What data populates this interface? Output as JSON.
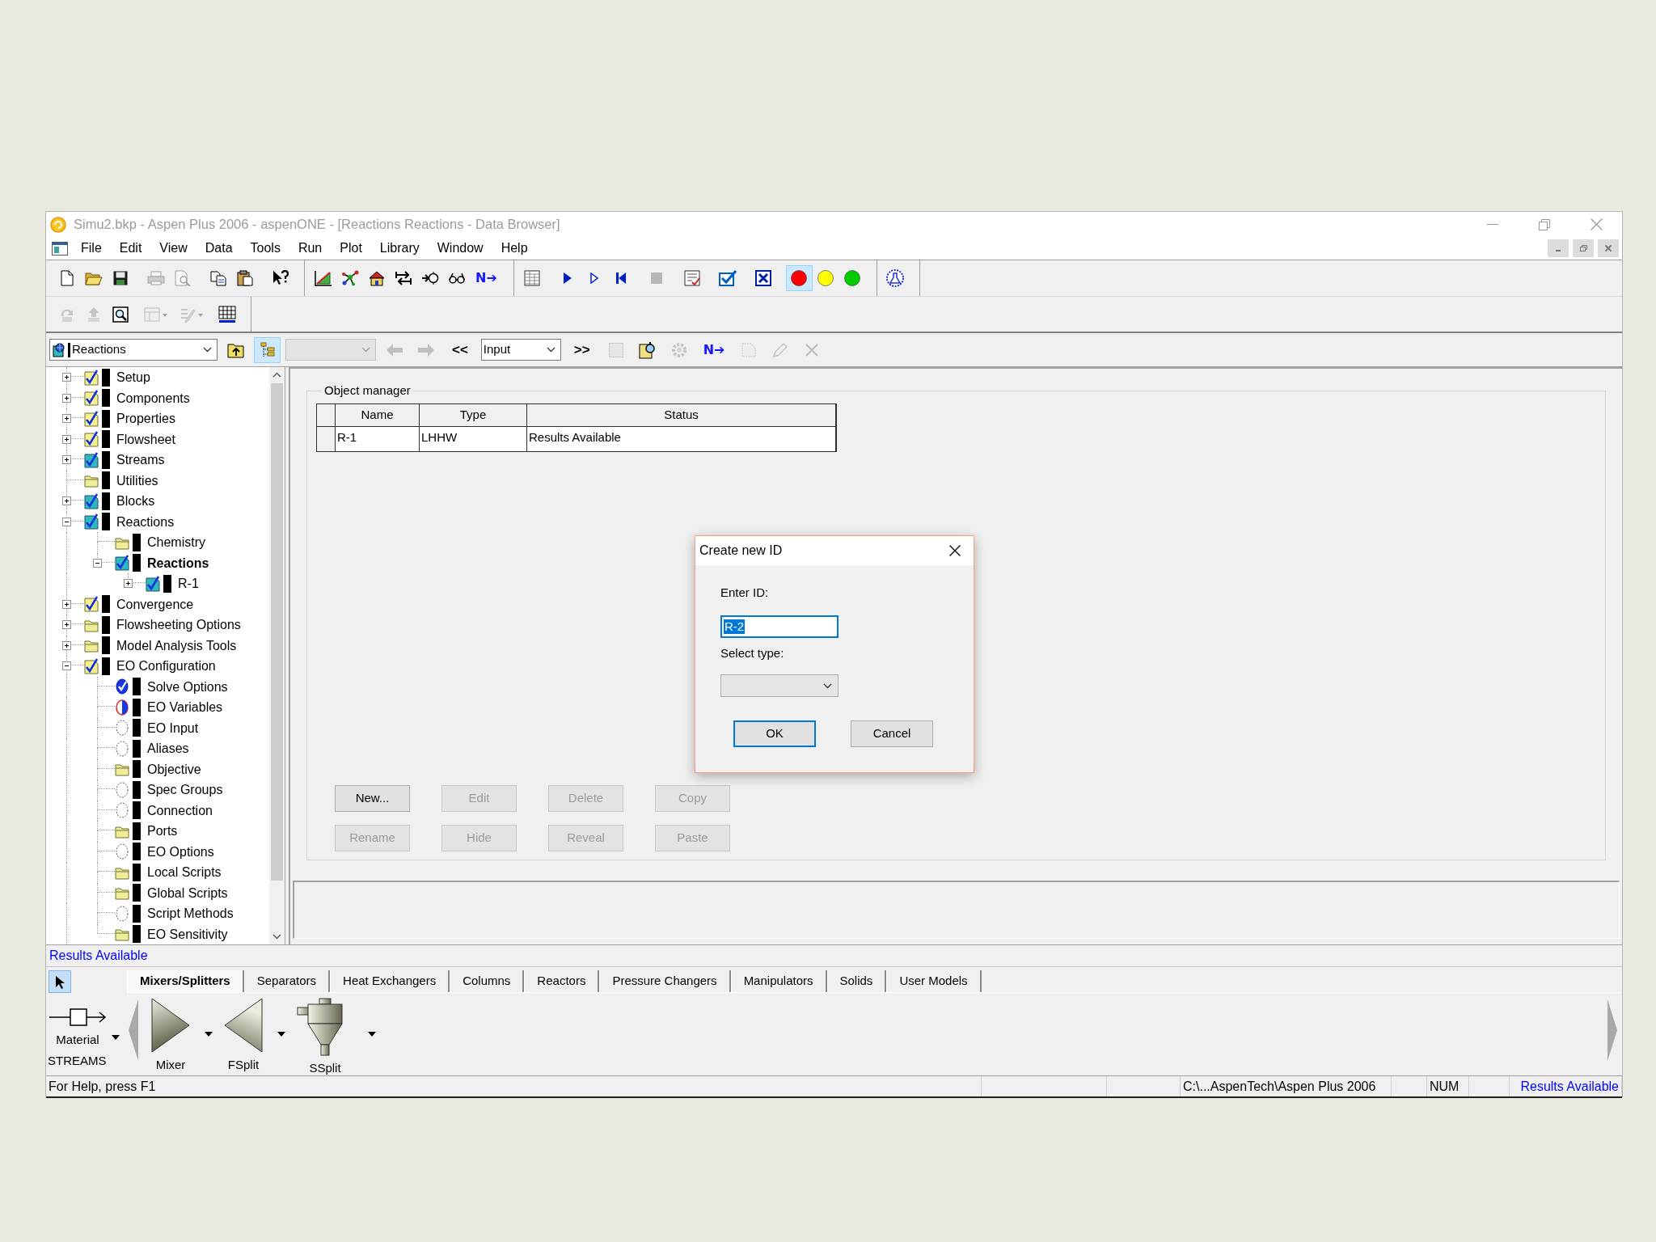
{
  "window": {
    "title": "Simu2.bkp - Aspen Plus 2006 - aspenONE - [Reactions Reactions - Data Browser]"
  },
  "menu": [
    "File",
    "Edit",
    "View",
    "Data",
    "Tools",
    "Run",
    "Plot",
    "Library",
    "Window",
    "Help"
  ],
  "toolbar_1": [
    [
      [
        {
          "kind": "new",
          "disabled": false,
          "pressed": false
        },
        {
          "kind": "open",
          "disabled": false,
          "pressed": false
        },
        {
          "kind": "save",
          "disabled": false,
          "pressed": false
        }
      ],
      [
        {
          "kind": "print",
          "disabled": true,
          "pressed": false
        },
        {
          "kind": "preview",
          "disabled": true,
          "pressed": false
        }
      ],
      [
        {
          "kind": "copy",
          "disabled": false,
          "pressed": false
        },
        {
          "kind": "paste",
          "disabled": false,
          "pressed": false
        }
      ],
      [
        {
          "kind": "help",
          "disabled": false,
          "pressed": false
        }
      ]
    ],
    [
      [
        {
          "kind": "chart",
          "disabled": false,
          "pressed": false
        },
        {
          "kind": "network",
          "disabled": false,
          "pressed": false
        },
        {
          "kind": "house",
          "disabled": false,
          "pressed": false
        },
        {
          "kind": "swap",
          "disabled": false,
          "pressed": false
        },
        {
          "kind": "node",
          "disabled": false,
          "pressed": false
        },
        {
          "kind": "glasses",
          "disabled": false,
          "pressed": false
        },
        {
          "kind": "next",
          "label": "N➔",
          "disabled": false,
          "pressed": false
        }
      ]
    ],
    [
      [
        {
          "kind": "table",
          "disabled": false,
          "pressed": false
        }
      ],
      [
        {
          "kind": "play",
          "disabled": false,
          "pressed": false
        },
        {
          "kind": "step",
          "disabled": false,
          "pressed": false
        },
        {
          "kind": "rewind",
          "disabled": false,
          "pressed": false
        }
      ],
      [
        {
          "kind": "stop",
          "disabled": true,
          "pressed": false
        }
      ],
      [
        {
          "kind": "checklist",
          "disabled": false,
          "pressed": false
        }
      ],
      [
        {
          "kind": "checkbox",
          "disabled": false,
          "pressed": false
        }
      ],
      [
        {
          "kind": "crossbox",
          "disabled": false,
          "pressed": false
        }
      ],
      [
        {
          "kind": "light",
          "color": "#ff0000",
          "disabled": false,
          "pressed": true
        },
        {
          "kind": "light",
          "color": "#ffff00",
          "disabled": false,
          "pressed": false
        },
        {
          "kind": "light",
          "color": "#00cc00",
          "disabled": false,
          "pressed": false
        }
      ]
    ],
    [
      [
        {
          "kind": "flask",
          "disabled": false,
          "pressed": false
        }
      ]
    ]
  ],
  "toolbar_2": [
    [
      [
        {
          "kind": "curve-left",
          "disabled": true,
          "pressed": false
        },
        {
          "kind": "curve-up",
          "disabled": true,
          "pressed": false
        },
        {
          "kind": "zoom-frame",
          "disabled": false,
          "pressed": false
        }
      ],
      [
        {
          "kind": "layout",
          "disabled": true,
          "pressed": false
        }
      ],
      [
        {
          "kind": "pencil-list",
          "disabled": true,
          "pressed": false
        }
      ],
      [
        {
          "kind": "grid-line",
          "disabled": false,
          "pressed": false
        }
      ]
    ]
  ],
  "browser_bar": [
    {
      "kind": "object-combo",
      "value": "Reactions",
      "disabled": false,
      "pressed": false
    },
    {
      "kind": "folder-up",
      "disabled": false,
      "pressed": false
    },
    {
      "kind": "tree-view",
      "disabled": false,
      "pressed": true
    },
    {
      "kind": "view-combo",
      "disabled": true,
      "pressed": false
    },
    {
      "kind": "back",
      "disabled": true,
      "pressed": false
    },
    {
      "kind": "forward",
      "disabled": true,
      "pressed": false
    },
    {
      "kind": "prev-glyph",
      "label": "<<",
      "disabled": false,
      "pressed": false
    },
    {
      "kind": "form-combo",
      "value": "Input",
      "disabled": false,
      "pressed": false
    },
    {
      "kind": "next-glyph",
      "label": ">>",
      "disabled": false,
      "pressed": false
    },
    {
      "kind": "dotted-square",
      "disabled": true,
      "pressed": false
    },
    {
      "kind": "doc-search",
      "disabled": false,
      "pressed": false
    },
    {
      "kind": "gear",
      "disabled": true,
      "pressed": false
    },
    {
      "kind": "next",
      "label": "N➔",
      "disabled": false,
      "pressed": false
    },
    {
      "kind": "dashed-page",
      "disabled": true,
      "pressed": false
    },
    {
      "kind": "pencil",
      "disabled": true,
      "pressed": false
    },
    {
      "kind": "cross",
      "disabled": true,
      "pressed": false
    }
  ],
  "tree": [
    {
      "label": "Setup",
      "kind": "check",
      "expanded": false,
      "selected": false
    },
    {
      "label": "Components",
      "kind": "check",
      "expanded": false,
      "selected": false
    },
    {
      "label": "Properties",
      "kind": "check",
      "expanded": false,
      "selected": false
    },
    {
      "label": "Flowsheet",
      "kind": "check",
      "expanded": false,
      "selected": false
    },
    {
      "label": "Streams",
      "kind": "check-teal",
      "expanded": false,
      "selected": false
    },
    {
      "label": "Utilities",
      "kind": "folder",
      "selected": false
    },
    {
      "label": "Blocks",
      "kind": "check-teal",
      "expanded": false,
      "selected": false
    },
    {
      "label": "Reactions",
      "kind": "check-teal",
      "expanded": true,
      "selected": false,
      "children": [
        {
          "label": "Chemistry",
          "kind": "folder",
          "selected": false
        },
        {
          "label": "Reactions",
          "kind": "check-teal",
          "expanded": true,
          "selected": true,
          "children": [
            {
              "label": "R-1",
              "kind": "check-teal",
              "expanded": false,
              "selected": false
            }
          ]
        }
      ]
    },
    {
      "label": "Convergence",
      "kind": "check",
      "expanded": false,
      "selected": false
    },
    {
      "label": "Flowsheeting Options",
      "kind": "folder",
      "expanded": false,
      "selected": false
    },
    {
      "label": "Model Analysis Tools",
      "kind": "folder",
      "expanded": false,
      "selected": false
    },
    {
      "label": "EO Configuration",
      "kind": "check",
      "expanded": true,
      "selected": false,
      "children": [
        {
          "label": "Solve Options",
          "kind": "solved",
          "selected": false
        },
        {
          "label": "EO Variables",
          "kind": "partial",
          "selected": false
        },
        {
          "label": "EO Input",
          "kind": "empty",
          "selected": false
        },
        {
          "label": "Aliases",
          "kind": "empty",
          "selected": false
        },
        {
          "label": "Objective",
          "kind": "folder",
          "selected": false
        },
        {
          "label": "Spec Groups",
          "kind": "empty",
          "selected": false
        },
        {
          "label": "Connection",
          "kind": "empty",
          "selected": false
        },
        {
          "label": "Ports",
          "kind": "folder",
          "selected": false
        },
        {
          "label": "EO Options",
          "kind": "empty",
          "selected": false
        },
        {
          "label": "Local Scripts",
          "kind": "folder",
          "selected": false
        },
        {
          "label": "Global Scripts",
          "kind": "folder",
          "selected": false
        },
        {
          "label": "Script Methods",
          "kind": "empty",
          "selected": false
        },
        {
          "label": "EO Sensitivity",
          "kind": "folder",
          "selected": false
        }
      ]
    }
  ],
  "object_manager": {
    "title": "Object manager",
    "columns": [
      "Name",
      "Type",
      "Status"
    ],
    "rows": [
      [
        "R-1",
        "LHHW",
        "Results Available"
      ]
    ],
    "buttons": [
      {
        "label": "New...",
        "disabled": false
      },
      {
        "label": "Edit",
        "disabled": true
      },
      {
        "label": "Delete",
        "disabled": true
      },
      {
        "label": "Copy",
        "disabled": true
      },
      {
        "label": "Rename",
        "disabled": true
      },
      {
        "label": "Hide",
        "disabled": true
      },
      {
        "label": "Reveal",
        "disabled": true
      },
      {
        "label": "Paste",
        "disabled": true
      }
    ]
  },
  "dialog": {
    "title": "Create new ID",
    "id_label": "Enter ID:",
    "id_value": "R-2",
    "id_value_selected": true,
    "type_label": "Select type:",
    "buttons": [
      {
        "label": "OK",
        "default": true
      },
      {
        "label": "Cancel",
        "default": false
      }
    ]
  },
  "results_line": "Results Available",
  "palette": {
    "select_tool": {
      "selected": true
    },
    "tabs": [
      {
        "label": "Mixers/Splitters",
        "selected": true
      },
      {
        "label": "Separators",
        "selected": false
      },
      {
        "label": "Heat Exchangers",
        "selected": false
      },
      {
        "label": "Columns",
        "selected": false
      },
      {
        "label": "Reactors",
        "selected": false
      },
      {
        "label": "Pressure Changers",
        "selected": false
      },
      {
        "label": "Manipulators",
        "selected": false
      },
      {
        "label": "Solids",
        "selected": false
      },
      {
        "label": "User Models",
        "selected": false
      }
    ],
    "stream": {
      "type": "Material",
      "group": "STREAMS"
    },
    "models": [
      {
        "kind": "mixer",
        "label": "Mixer"
      },
      {
        "kind": "fsplit",
        "label": "FSplit"
      },
      {
        "kind": "ssplit",
        "label": "SSplit"
      }
    ]
  },
  "status_bar": {
    "help": "For Help, press F1",
    "path": "C:\\...AspenTech\\Aspen Plus 2006",
    "keys": "NUM",
    "status": "Results Available"
  }
}
